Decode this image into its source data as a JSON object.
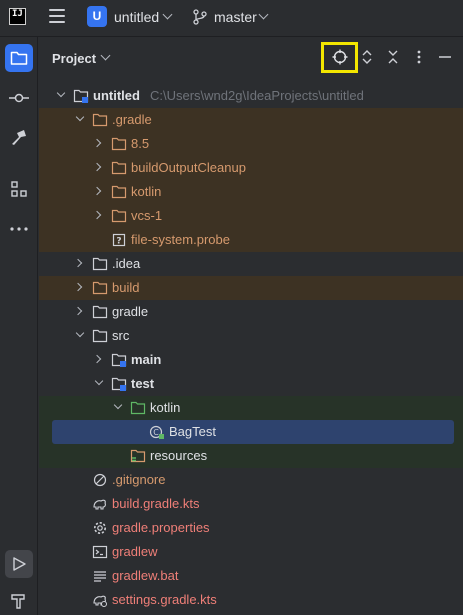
{
  "titlebar": {
    "logo_text": "IJ",
    "project_badge": "U",
    "project_name": "untitled",
    "branch_name": "master"
  },
  "left_stripe": {
    "items": [
      "folder-icon",
      "commit-icon",
      "build-hammer-icon",
      "structure-icon",
      "more-icon",
      "run-icon",
      "build-icon"
    ]
  },
  "panel": {
    "title": "Project"
  },
  "tree": {
    "root": {
      "label": "untitled",
      "path": "C:\\Users\\wnd2g\\IdeaProjects\\untitled"
    },
    "gradle_dir": ".gradle",
    "gradle_children": [
      "8.5",
      "buildOutputCleanup",
      "kotlin",
      "vcs-1"
    ],
    "fs_probe": "file-system.probe",
    "idea": ".idea",
    "build": "build",
    "gradle": "gradle",
    "src": "src",
    "main": "main",
    "test": "test",
    "kotlin": "kotlin",
    "bagtest": "BagTest",
    "resources": "resources",
    "files": [
      ".gitignore",
      "build.gradle.kts",
      "gradle.properties",
      "gradlew",
      "gradlew.bat",
      "settings.gradle.kts"
    ]
  },
  "colors": {
    "accent": "#3574f0",
    "excluded_bg": "#3d3223",
    "test_bg": "#273328",
    "selection": "#2e436e",
    "highlight_box": "#f3e600"
  }
}
